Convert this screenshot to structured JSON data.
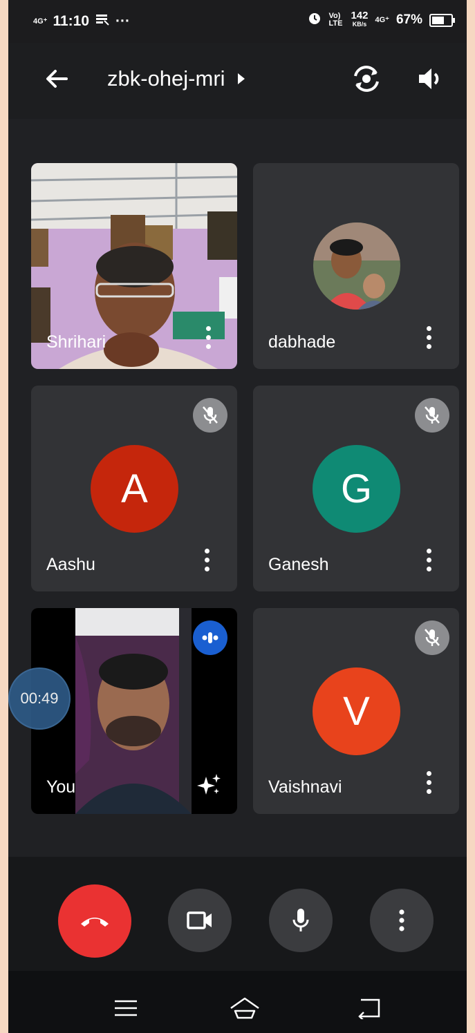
{
  "status_bar": {
    "network_left": "4G⁺",
    "time": "11:10",
    "more_indicator": "···",
    "volte": "Vo) LTE",
    "speed_value": "142",
    "speed_unit": "KB/s",
    "network_right": "4G⁺",
    "battery_percent": "67%",
    "battery_level": 0.67
  },
  "header": {
    "meeting_code": "zbk-ohej-mri"
  },
  "participants": [
    {
      "name": "Shrihari",
      "type": "video"
    },
    {
      "name": "dabhade",
      "type": "photo"
    },
    {
      "name": "Aashu",
      "initial": "A",
      "color": "#c5260c",
      "muted": true
    },
    {
      "name": "Ganesh",
      "initial": "G",
      "color": "#0f8a74",
      "muted": true
    },
    {
      "name": "You",
      "type": "self-video"
    },
    {
      "name": "Vaishnavi",
      "initial": "V",
      "color": "#e8431c",
      "muted": true
    }
  ],
  "timer": "00:49",
  "controls": {
    "end_call": "end-call",
    "camera": "camera",
    "mic": "microphone",
    "more": "more-options"
  },
  "icons": {
    "back": "arrow-left-icon",
    "switch_camera": "switch-camera-icon",
    "speaker": "speaker-icon",
    "mic_off": "mic-off-icon",
    "effects": "sparkle-icon",
    "speaking": "speaking-indicator-icon"
  }
}
